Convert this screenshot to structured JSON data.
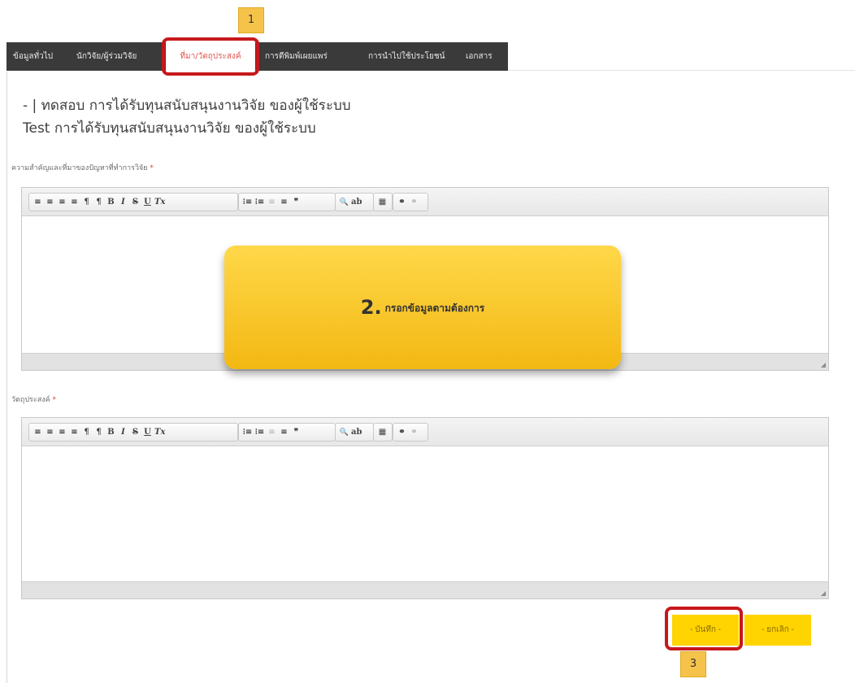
{
  "nav": {
    "tabs": [
      {
        "label": "ข้อมูลทั่วไป",
        "active": false
      },
      {
        "label": "นักวิจัย/ผู้ร่วมวิจัย",
        "active": false
      },
      {
        "label": "ที่มา/วัตถุประสงค์",
        "active": true
      },
      {
        "label": "การตีพิมพ์เผยแพร่",
        "active": false
      },
      {
        "label": "การนำไปใช้ประโยชน์",
        "active": false
      },
      {
        "label": "เอกสาร",
        "active": false
      }
    ]
  },
  "page": {
    "title_line1": "- | ทดสอบ การได้รับทุนสนับสนุนงานวิจัย ของผู้ใช้ระบบ",
    "title_line2": "Test การได้รับทุนสนับสนุนงานวิจัย ของผู้ใช้ระบบ"
  },
  "fields": {
    "background_label": "ความสำคัญและที่มาของปัญหาที่ทำการวิจัย",
    "objective_label": "วัตถุประสงค์",
    "required_mark": "*"
  },
  "toolbar": {
    "groups": [
      [
        "≡",
        "≡",
        "≡",
        "≡",
        "¶",
        "¶",
        "B",
        "I",
        "S",
        "U",
        "Tx"
      ],
      [
        "⁝≡",
        "⁝≡",
        "≡",
        "≡",
        "❞"
      ],
      [
        "🔍",
        "ab"
      ],
      [
        "▦"
      ],
      [
        "⚭",
        "⚭"
      ]
    ]
  },
  "annotations": {
    "step1": "1",
    "step2_number": "2.",
    "step2_text": "กรอกข้อมูลตามต้องการ",
    "step3": "3",
    "highlight_color": "#c6181c",
    "callout_color": "#f5c34a"
  },
  "actions": {
    "save_label": "- บันทึก -",
    "cancel_label": "- ยกเลิก -",
    "button_color": "#ffd400"
  }
}
